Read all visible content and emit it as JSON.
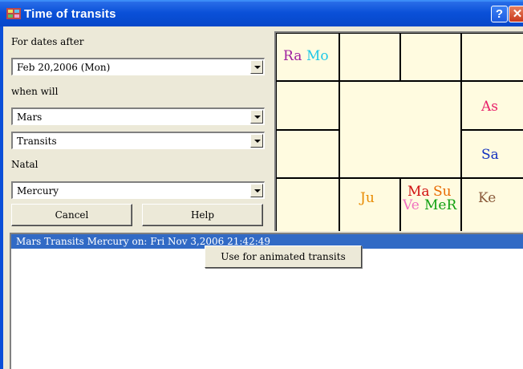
{
  "window": {
    "title": "Time of transits",
    "help_glyph": "?",
    "close_glyph": "✕",
    "icon": "app-chart-icon"
  },
  "form": {
    "dates_label": "For dates after",
    "date_value": "Feb 20,2006  (Mon)",
    "when_label": "when will",
    "planet_value": "Mars",
    "event_value": "Transits",
    "natal_label": "Natal",
    "natal_value": "Mercury",
    "cancel_label": "Cancel",
    "help_label": "Help"
  },
  "chart": {
    "cells": {
      "top_left": [
        {
          "text": "Ra",
          "color": "#a020a0"
        },
        {
          "text": "Mo",
          "color": "#20c8e8"
        }
      ],
      "right_mid_upper": [
        {
          "text": "As",
          "color": "#e8206a"
        }
      ],
      "right_mid_lower": [
        {
          "text": "Sa",
          "color": "#1030c0"
        }
      ],
      "bottom_2": [
        {
          "text": "Ju",
          "color": "#e88a00"
        }
      ],
      "bottom_3_line1": [
        {
          "text": "Ma",
          "color": "#d01010"
        },
        {
          "text": "Su",
          "color": "#e86a00"
        }
      ],
      "bottom_3_line2": [
        {
          "text": "Ve",
          "color": "#f070c0"
        },
        {
          "text": "MeR",
          "color": "#10a010"
        }
      ],
      "bottom_right": [
        {
          "text": "Ke",
          "color": "#8a5a3a"
        }
      ]
    }
  },
  "results": {
    "selected_row": "Mars  Transits  Mercury on: Fri Nov 3,2006  21:42:49"
  },
  "context_menu": {
    "item": "Use for animated transits"
  },
  "colors": {
    "titlebar": "#0a50d8",
    "selection": "#316ac5",
    "chart_bg": "#fffbe0"
  }
}
